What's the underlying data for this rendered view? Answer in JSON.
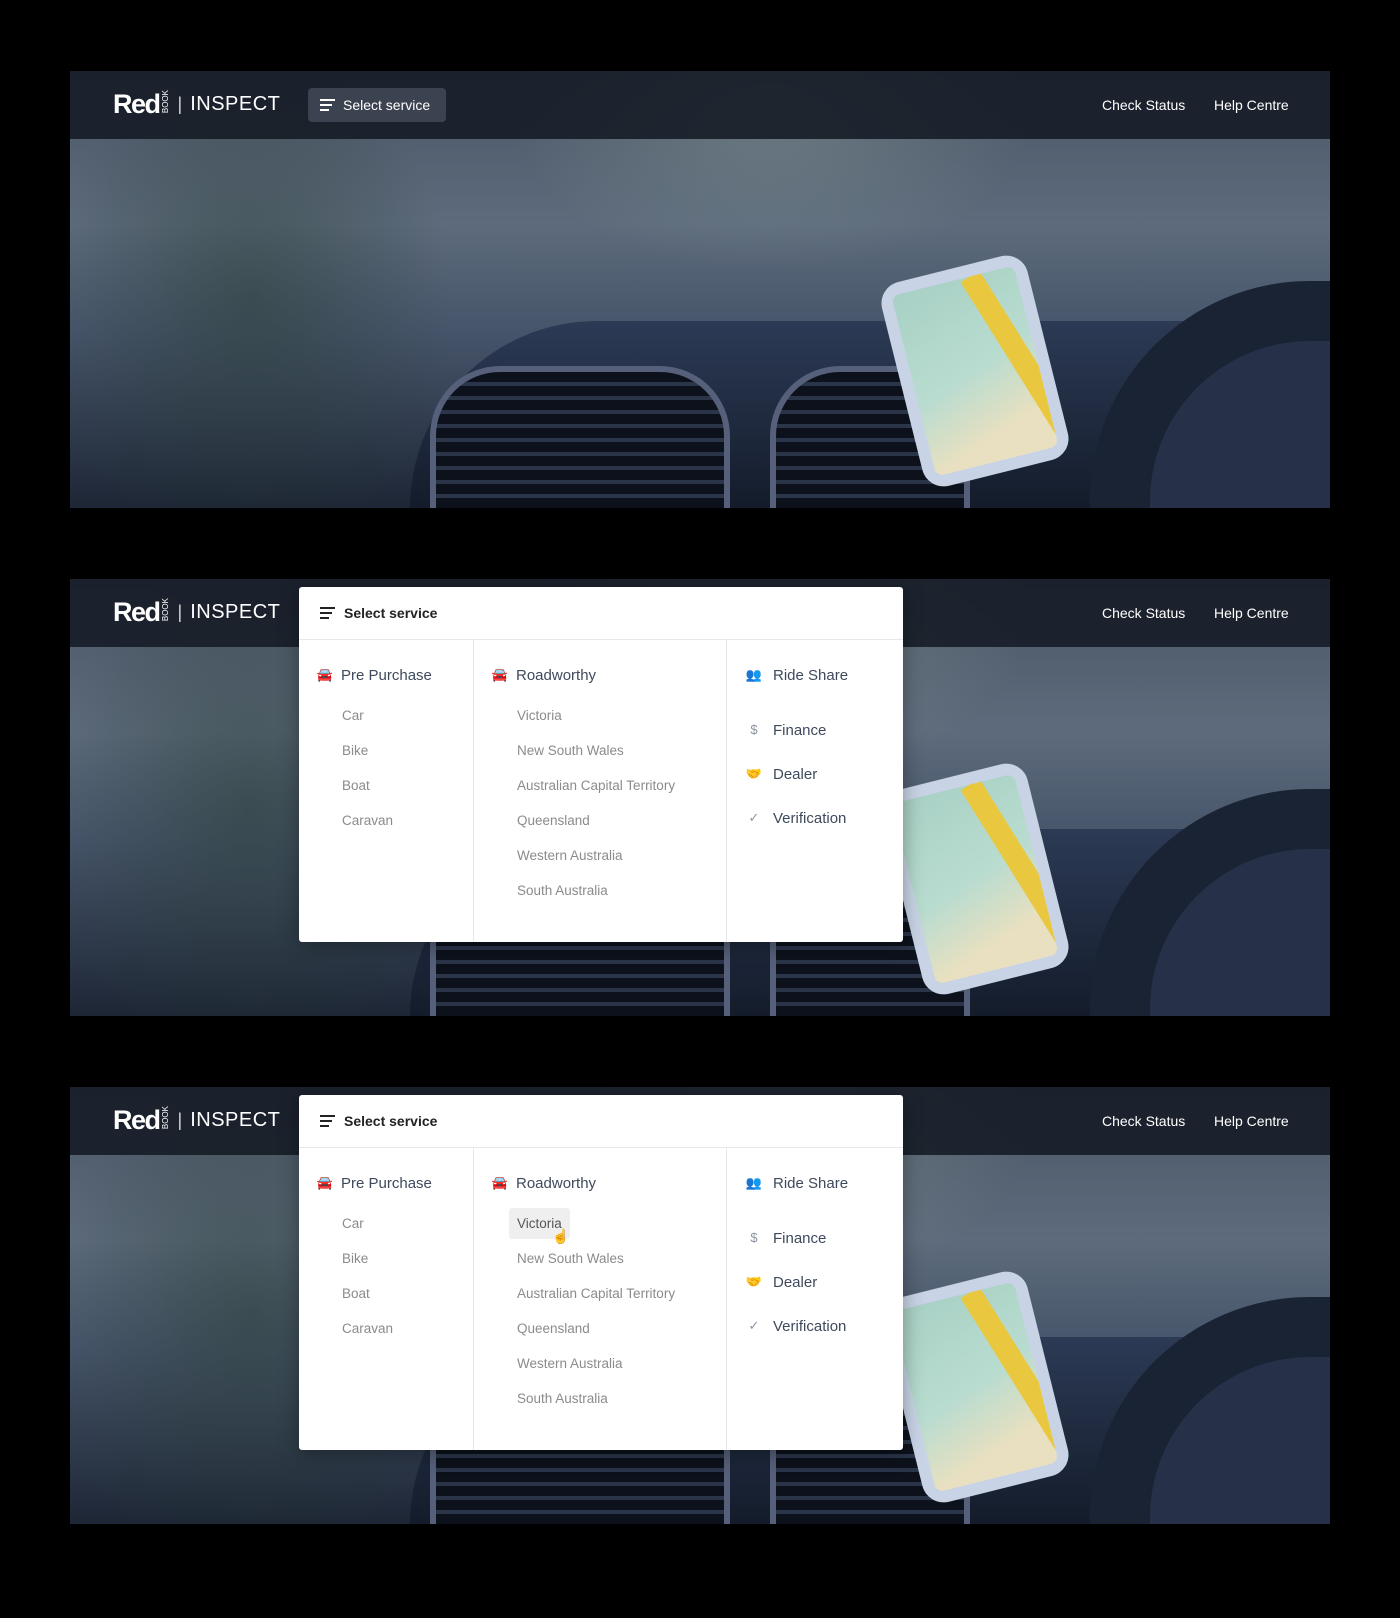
{
  "brand": {
    "logo_main": "Red",
    "logo_small": "BOOK",
    "product": "INSPECT"
  },
  "header": {
    "select_service": "Select service",
    "check_status": "Check Status",
    "help_centre": "Help Centre"
  },
  "menu": {
    "title": "Select service",
    "pre_purchase": {
      "label": "Pre Purchase",
      "icon": "car-search-icon",
      "items": [
        "Car",
        "Bike",
        "Boat",
        "Caravan"
      ]
    },
    "roadworthy": {
      "label": "Roadworthy",
      "icon": "car-check-icon",
      "items": [
        "Victoria",
        "New South Wales",
        "Australian Capital Territory",
        "Queensland",
        "Western Australia",
        "South Australia"
      ]
    },
    "services": [
      {
        "label": "Ride Share",
        "icon": "ride-share-icon"
      },
      {
        "label": "Finance",
        "icon": "finance-icon"
      },
      {
        "label": "Dealer",
        "icon": "handshake-icon"
      },
      {
        "label": "Verification",
        "icon": "verification-icon"
      }
    ]
  },
  "states": [
    {
      "menu_open": false,
      "hovered": null
    },
    {
      "menu_open": true,
      "hovered": null
    },
    {
      "menu_open": true,
      "hovered": "Victoria"
    }
  ]
}
